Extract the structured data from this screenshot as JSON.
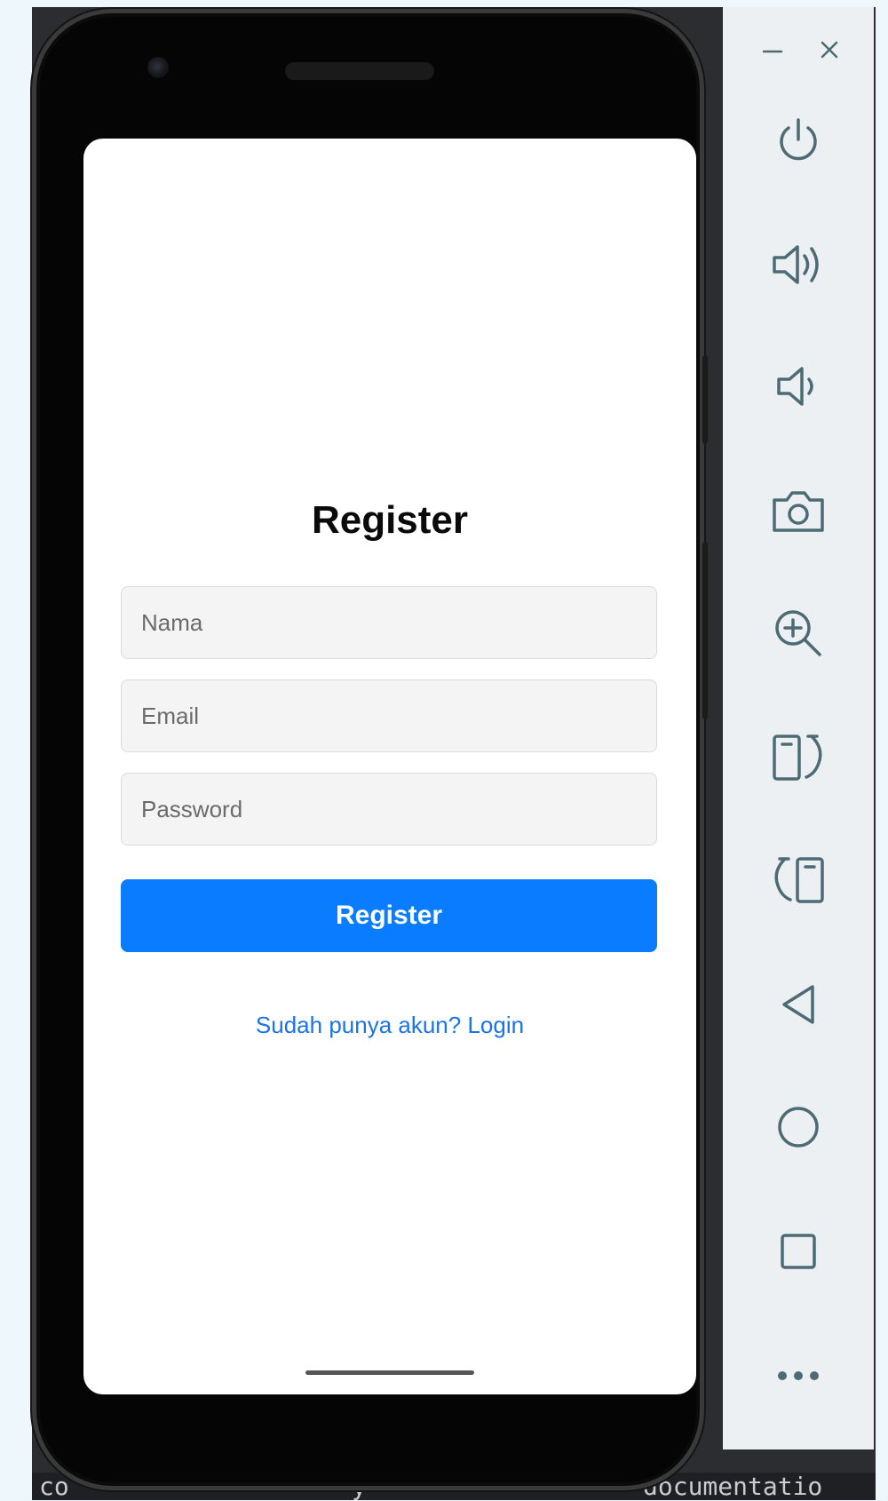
{
  "screen": {
    "title": "Register",
    "fields": {
      "name": {
        "placeholder": "Nama",
        "value": ""
      },
      "email": {
        "placeholder": "Email",
        "value": ""
      },
      "password": {
        "placeholder": "Password",
        "value": ""
      }
    },
    "register_button_label": "Register",
    "login_link_text": "Sudah punya akun? Login"
  },
  "ide_footer": {
    "left_text": "co",
    "middle_text": "y",
    "right_text": "documentatio"
  },
  "toolbar": {
    "icons": [
      "minimize-icon",
      "close-icon",
      "power-icon",
      "volume-up-icon",
      "volume-down-icon",
      "camera-icon",
      "zoom-in-icon",
      "rotate-right-icon",
      "rotate-left-icon",
      "back-icon",
      "home-icon",
      "overview-icon",
      "more-icon"
    ]
  },
  "colors": {
    "primary_button": "#0a7cff",
    "link": "#1a73e8",
    "toolbar_icon": "#4d6b74"
  }
}
